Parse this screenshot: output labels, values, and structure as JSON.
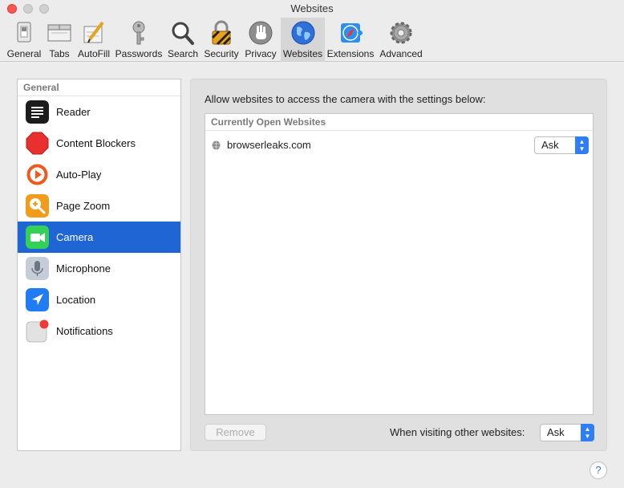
{
  "window": {
    "title": "Websites"
  },
  "toolbar": {
    "items": [
      {
        "label": "General",
        "icon": "general-icon"
      },
      {
        "label": "Tabs",
        "icon": "tabs-icon"
      },
      {
        "label": "AutoFill",
        "icon": "autofill-icon"
      },
      {
        "label": "Passwords",
        "icon": "key-icon"
      },
      {
        "label": "Search",
        "icon": "magnifier-icon"
      },
      {
        "label": "Security",
        "icon": "padlock-icon"
      },
      {
        "label": "Privacy",
        "icon": "hand-icon"
      },
      {
        "label": "Websites",
        "icon": "globe-icon"
      },
      {
        "label": "Extensions",
        "icon": "extensions-icon"
      },
      {
        "label": "Advanced",
        "icon": "gear-icon"
      }
    ],
    "active": "Websites"
  },
  "sidebar": {
    "header": "General",
    "items": [
      {
        "label": "Reader",
        "icon": "reader-icon"
      },
      {
        "label": "Content Blockers",
        "icon": "stop-sign-icon"
      },
      {
        "label": "Auto-Play",
        "icon": "play-icon"
      },
      {
        "label": "Page Zoom",
        "icon": "zoom-icon"
      },
      {
        "label": "Camera",
        "icon": "camera-icon"
      },
      {
        "label": "Microphone",
        "icon": "microphone-icon"
      },
      {
        "label": "Location",
        "icon": "location-arrow-icon"
      },
      {
        "label": "Notifications",
        "icon": "notifications-icon"
      }
    ],
    "selected": "Camera"
  },
  "main": {
    "description": "Allow websites to access the camera with the settings below:",
    "table_header": "Currently Open Websites",
    "websites": [
      {
        "name": "browserleaks.com",
        "setting": "Ask"
      }
    ],
    "remove_label": "Remove",
    "other_label": "When visiting other websites:",
    "other_value": "Ask"
  },
  "help": {
    "label": "?"
  },
  "colors": {
    "selection": "#1f65d4",
    "accent": "#2f7ef5",
    "close": "#fc5753"
  }
}
